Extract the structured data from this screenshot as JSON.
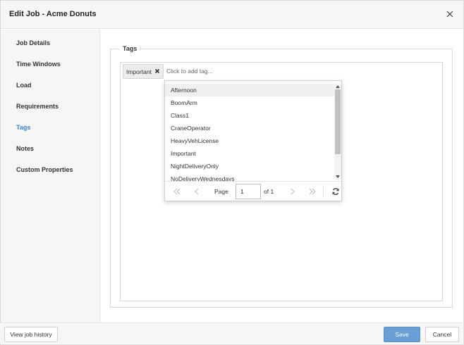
{
  "dialog": {
    "title": "Edit Job - Acme Donuts"
  },
  "sidebar": {
    "items": [
      {
        "label": "Job Details"
      },
      {
        "label": "Time Windows"
      },
      {
        "label": "Load"
      },
      {
        "label": "Requirements"
      },
      {
        "label": "Tags",
        "active": true
      },
      {
        "label": "Notes"
      },
      {
        "label": "Custom Properties"
      }
    ]
  },
  "tags": {
    "legend": "Tags",
    "selected": [
      "Important"
    ],
    "input_placeholder": "Click to add tag..."
  },
  "dropdown": {
    "options": [
      "Afternoon",
      "BoomArm",
      "Class1",
      "CraneOperator",
      "HeavyVehLicense",
      "Important",
      "NightDeliveryOnly",
      "NoDeliveryWednesdays"
    ],
    "hovered": "Afternoon",
    "pager": {
      "page_label": "Page",
      "page_value": "1",
      "of_label": "of 1"
    }
  },
  "footer": {
    "history_label": "View job history",
    "save_label": "Save",
    "cancel_label": "Cancel"
  },
  "colors": {
    "accent": "#3a7fc3",
    "save_button": "#6a9fd6"
  },
  "icons": [
    "close-icon",
    "remove-tag-icon",
    "first-page-icon",
    "prev-page-icon",
    "next-page-icon",
    "last-page-icon",
    "refresh-icon"
  ]
}
